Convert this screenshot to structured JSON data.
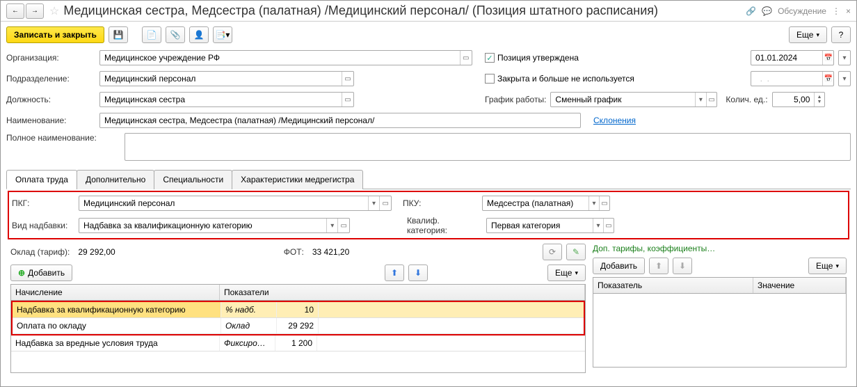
{
  "titlebar": {
    "title": "Медицинская сестра, Медсестра (палатная) /Медицинский персонал/ (Позиция штатного расписания)",
    "discuss": "Обсуждение"
  },
  "toolbar": {
    "save_close": "Записать и закрыть",
    "more": "Еще",
    "help": "?"
  },
  "fields": {
    "org_label": "Организация:",
    "org_value": "Медицинское учреждение РФ",
    "approved_label": "Позиция утверждена",
    "date_value": "01.01.2024",
    "dept_label": "Подразделение:",
    "dept_value": "Медицинский персонал",
    "closed_label": "Закрыта и больше не используется",
    "closed_date": "  .  .    ",
    "position_label": "Должность:",
    "position_value": "Медицинская сестра",
    "schedule_label": "График работы:",
    "schedule_value": "Сменный график",
    "qty_label": "Колич. ед.:",
    "qty_value": "5,00",
    "name_label": "Наименование:",
    "name_value": "Медицинская сестра, Медсестра (палатная) /Медицинский персонал/",
    "declensions": "Склонения",
    "fullname_label": "Полное наименование:"
  },
  "tabs": {
    "t1": "Оплата труда",
    "t2": "Дополнительно",
    "t3": "Специальности",
    "t4": "Характеристики медрегистра"
  },
  "pay": {
    "pkg_label": "ПКГ:",
    "pkg_value": "Медицинский персонал",
    "pku_label": "ПКУ:",
    "pku_value": "Медсестра (палатная)",
    "bonus_type_label": "Вид надбавки:",
    "bonus_type_value": "Надбавка за квалификационную категорию",
    "qualif_label": "Квалиф. категория:",
    "qualif_value": "Первая категория",
    "salary_label": "Оклад (тариф):",
    "salary_value": "29 292,00",
    "fot_label": "ФОТ:",
    "fot_value": "33 421,20",
    "add": "Добавить",
    "more": "Еще"
  },
  "accruals": {
    "header_accrual": "Начисление",
    "header_indicators": "Показатели",
    "rows": [
      {
        "name": "Надбавка за квалификационную категорию",
        "ind": "% надб.",
        "val": "10"
      },
      {
        "name": "Оплата по окладу",
        "ind": "Оклад",
        "val": "29 292"
      },
      {
        "name": "Надбавка за вредные условия труда",
        "ind": "Фиксиро…",
        "val": "1 200"
      }
    ]
  },
  "side": {
    "title": "Доп. тарифы, коэффициенты…",
    "add": "Добавить",
    "more": "Еще",
    "col1": "Показатель",
    "col2": "Значение"
  }
}
